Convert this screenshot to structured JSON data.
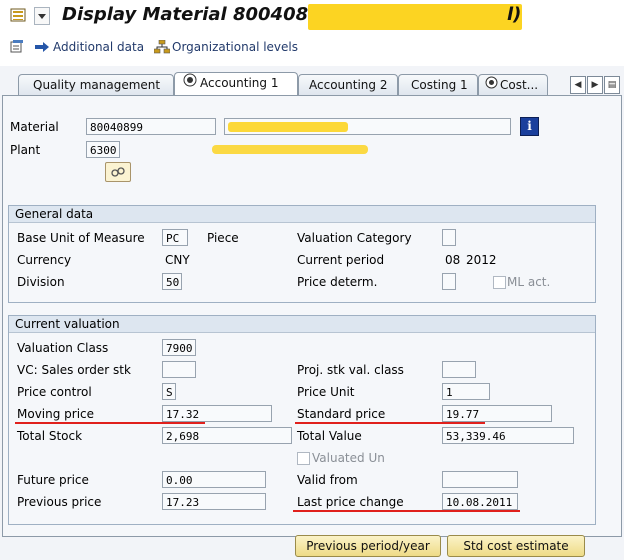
{
  "title": {
    "text": "Display Material 80040899 (",
    "suffix": "l)"
  },
  "toolbar": {
    "additional_data": "Additional data",
    "organizational_levels": "Organizational levels"
  },
  "tabs": [
    {
      "label": "Quality management",
      "active": false
    },
    {
      "label": "Accounting 1",
      "active": true
    },
    {
      "label": "Accounting 2",
      "active": false
    },
    {
      "label": "Costing 1",
      "active": false
    },
    {
      "label": "Cost...",
      "active": false
    }
  ],
  "header": {
    "material_label": "Material",
    "material_value": "80040899",
    "plant_label": "Plant",
    "plant_value": "6300"
  },
  "general_data": {
    "title": "General data",
    "base_uom_label": "Base Unit of Measure",
    "base_uom_value": "PC",
    "base_uom_text": "Piece",
    "currency_label": "Currency",
    "currency_value": "CNY",
    "division_label": "Division",
    "division_value": "50",
    "valuation_category_label": "Valuation Category",
    "valuation_category_value": "",
    "current_period_label": "Current period",
    "current_period_month": "08",
    "current_period_year": "2012",
    "price_determ_label": "Price determ.",
    "price_determ_value": "",
    "ml_act_label": "ML act."
  },
  "current_valuation": {
    "title": "Current valuation",
    "valuation_class_label": "Valuation Class",
    "valuation_class_value": "7900",
    "vc_sales_order_label": "VC: Sales order stk",
    "vc_sales_order_value": "",
    "proj_stk_label": "Proj. stk val. class",
    "proj_stk_value": "",
    "price_control_label": "Price control",
    "price_control_value": "S",
    "price_unit_label": "Price Unit",
    "price_unit_value": "1",
    "moving_price_label": "Moving price",
    "moving_price_value": "17.32",
    "standard_price_label": "Standard price",
    "standard_price_value": "19.77",
    "total_stock_label": "Total Stock",
    "total_stock_value": "2,698",
    "total_value_label": "Total Value",
    "total_value_value": "53,339.46",
    "valuated_un_label": "Valuated Un",
    "future_price_label": "Future price",
    "future_price_value": "0.00",
    "valid_from_label": "Valid from",
    "valid_from_value": "",
    "previous_price_label": "Previous price",
    "previous_price_value": "17.23",
    "last_price_change_label": "Last price change",
    "last_price_change_value": "10.08.2011"
  },
  "buttons": {
    "previous_period": "Previous period/year",
    "std_cost_estimate": "Std cost estimate"
  },
  "colors": {
    "redaction": "#fcd422",
    "annotation_underline": "#e0201c",
    "button_face": "#f4e4a0",
    "tab_border": "#8d9aa8"
  },
  "icons": [
    "menu-icon",
    "dropdown-icon",
    "additional-data-icon",
    "org-levels-icon",
    "tab-active-icon",
    "tab-scroll-left-icon",
    "tab-scroll-right-icon",
    "tab-list-icon",
    "info-icon",
    "plant-link-icon"
  ]
}
